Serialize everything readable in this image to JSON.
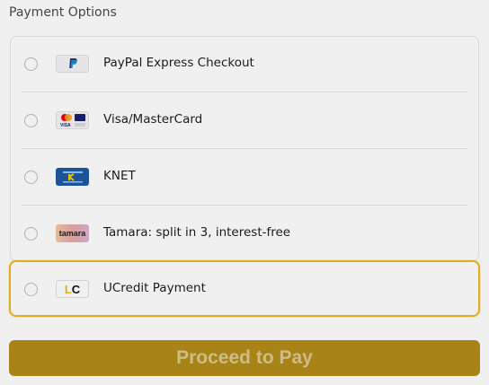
{
  "page": {
    "title": "Payment Options"
  },
  "payment_options": [
    {
      "label": "PayPal Express Checkout",
      "icon": "paypal-logo-icon",
      "selected": false
    },
    {
      "label": "Visa/MasterCard",
      "icon": "visa-mastercard-logo-icon",
      "selected": false
    },
    {
      "label": "KNET",
      "icon": "knet-logo-icon",
      "selected": false
    },
    {
      "label": "Tamara: split in 3, interest-free",
      "icon": "tamara-logo-icon",
      "selected": false
    },
    {
      "label": "UCredit Payment",
      "icon": "ucredit-logo-icon",
      "selected": false
    }
  ],
  "logos": {
    "tamara_text": "tamara",
    "ucredit_text_l": "L",
    "ucredit_text_c": "C"
  },
  "actions": {
    "proceed_label": "Proceed to Pay"
  },
  "colors": {
    "accent": "#f0b823",
    "button_bg": "#b28c1a",
    "button_text": "#dcc88c"
  }
}
